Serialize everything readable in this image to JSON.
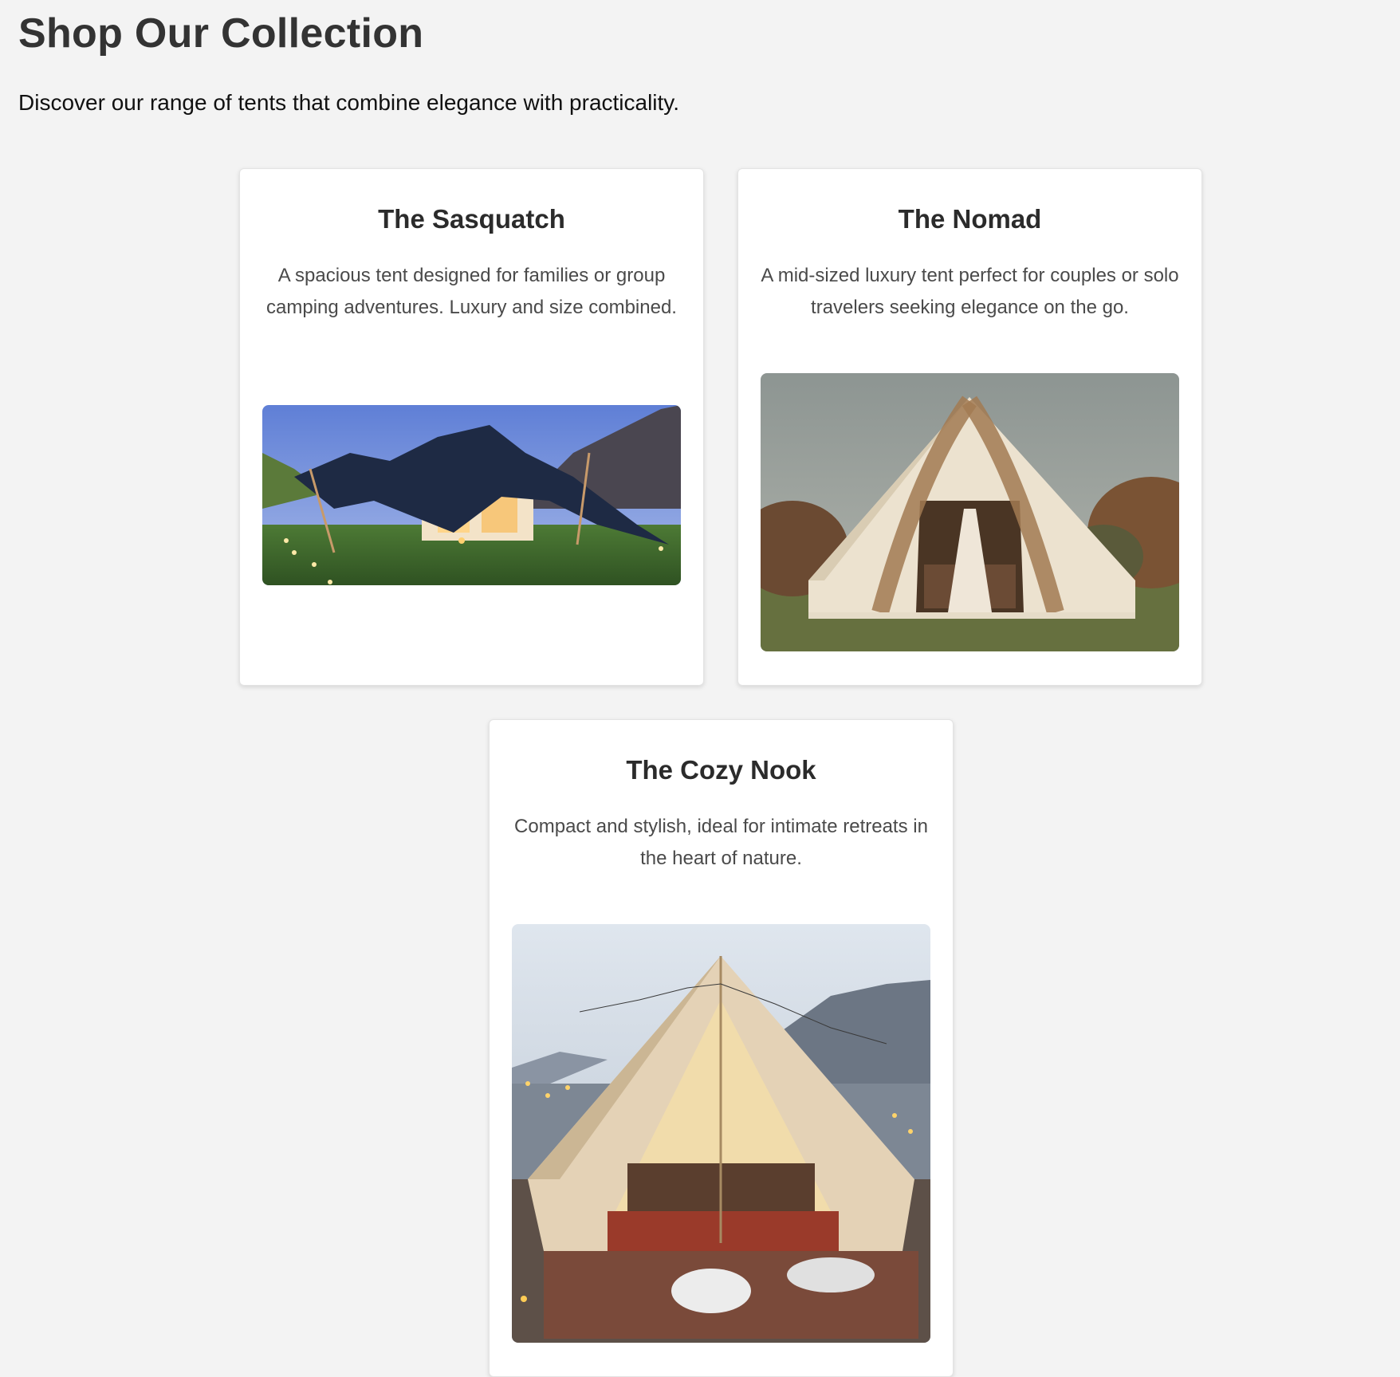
{
  "page": {
    "title": "Shop Our Collection",
    "subtitle": "Discover our range of tents that combine elegance with practicality."
  },
  "products": [
    {
      "name": "The Sasquatch",
      "description": "A spacious tent designed for families or group camping adventures. Luxury and size combined.",
      "image_icon": "stretch-tent-dusk-photo"
    },
    {
      "name": "The Nomad",
      "description": "A mid-sized luxury tent perfect for couples or solo travelers seeking elegance on the go.",
      "image_icon": "bell-tent-pampas-photo"
    },
    {
      "name": "The Cozy Nook",
      "description": "Compact and stylish, ideal for intimate retreats in the heart of nature.",
      "image_icon": "bell-tent-lakeside-photo"
    }
  ],
  "colors": {
    "background": "#f3f3f3",
    "card": "#ffffff",
    "title": "#333333",
    "text": "#4a4a4a"
  }
}
